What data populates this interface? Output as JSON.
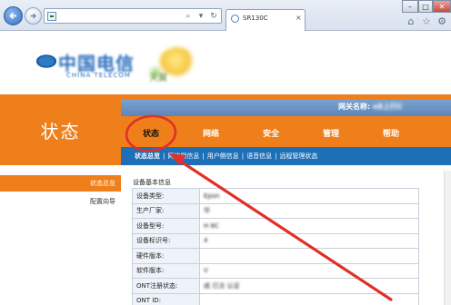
{
  "browser": {
    "tab_title": "SR130C",
    "tab_close_glyph": "×",
    "address_placeholder": "",
    "window_controls": {
      "minimize": "–",
      "maximize": "□",
      "close": "✕"
    },
    "icons": [
      "back-icon",
      "forward-icon",
      "site-icon",
      "search-icon",
      "refresh-icon",
      "tab-page-icon",
      "home-icon",
      "favorites-star-icon",
      "settings-gear-icon"
    ]
  },
  "brand": {
    "logo_text": "中国电信",
    "logo_subtext": "CHINA TELECOM",
    "secondary_logo_text": "天翼"
  },
  "header": {
    "page_heading": "状态",
    "gateway_label": "网关名称:",
    "gateway_value": "e8上行C"
  },
  "menu": {
    "items": [
      {
        "label": "状态",
        "active": true
      },
      {
        "label": "网络",
        "active": false
      },
      {
        "label": "安全",
        "active": false
      },
      {
        "label": "管理",
        "active": false
      },
      {
        "label": "帮助",
        "active": false
      }
    ]
  },
  "subnav": {
    "items": [
      {
        "label": "状态总览",
        "active": true
      },
      {
        "label": "网络侧信息",
        "active": false
      },
      {
        "label": "用户侧信息",
        "active": false
      },
      {
        "label": "语音信息",
        "active": false
      },
      {
        "label": "远程管理状态",
        "active": false
      }
    ],
    "separator": "|"
  },
  "sidebar": {
    "items": [
      {
        "label": "状态总览",
        "active": true
      },
      {
        "label": "配置向导",
        "active": false
      }
    ]
  },
  "device_info": {
    "section_title": "设备基本信息",
    "rows": [
      {
        "label": "设备类型:",
        "value": "Epon"
      },
      {
        "label": "生产厂家:",
        "value": "华"
      },
      {
        "label": "设备型号:",
        "value": "H 8C"
      },
      {
        "label": "设备标识号:",
        "value": "4"
      },
      {
        "label": "硬件版本:",
        "value": ""
      },
      {
        "label": "软件版本:",
        "value": "V"
      },
      {
        "label": "ONT注册状态:",
        "value": "成  已注   认证"
      },
      {
        "label": "ONT ID:",
        "value": ""
      }
    ]
  },
  "annotation": {
    "color": "#e0302a",
    "type": "circle-and-arrow"
  }
}
